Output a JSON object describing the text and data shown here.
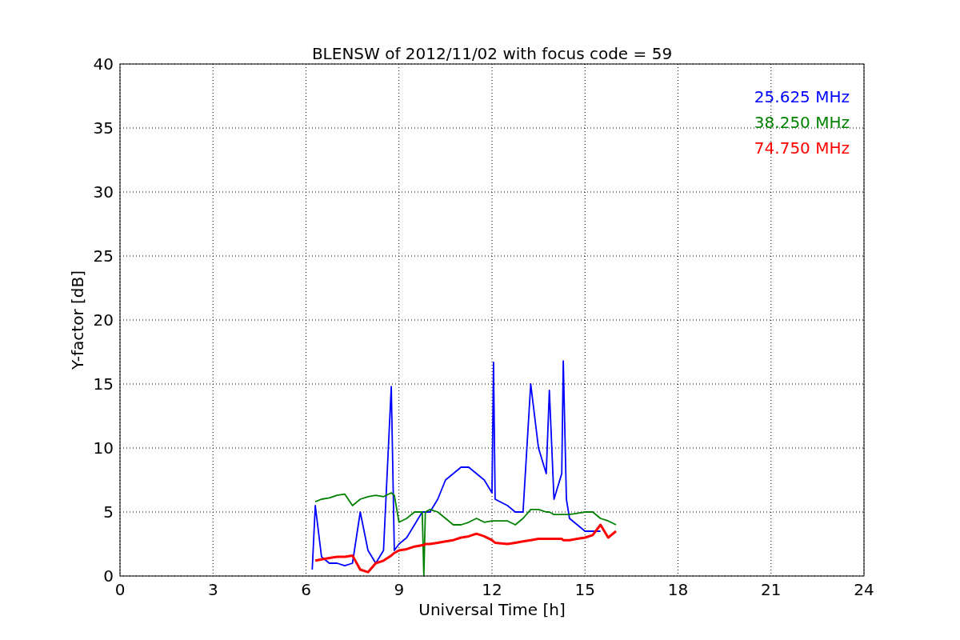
{
  "figure": {
    "chart_data": {
      "type": "line",
      "grid": true,
      "title": "BLENSW of 2012/11/02 with focus code = 59",
      "xlabel": "Universal Time [h]",
      "ylabel": "Y-factor [dB]",
      "xlim": [
        0,
        24
      ],
      "ylim": [
        0,
        40
      ],
      "xticks": [
        0,
        3,
        6,
        9,
        12,
        15,
        18,
        21,
        24
      ],
      "yticks": [
        0,
        5,
        10,
        15,
        20,
        25,
        30,
        35,
        40
      ],
      "x": [
        6.2,
        6.3,
        6.5,
        6.75,
        7,
        7.25,
        7.5,
        7.75,
        8,
        8.25,
        8.5,
        8.75,
        8.85,
        9,
        9.25,
        9.5,
        9.75,
        9.8,
        9.85,
        10,
        10.25,
        10.5,
        10.75,
        11,
        11.25,
        11.5,
        11.75,
        12,
        12.05,
        12.1,
        12.5,
        12.75,
        13,
        13.25,
        13.5,
        13.75,
        13.85,
        14,
        14.25,
        14.3,
        14.4,
        14.5,
        14.75,
        15,
        15.25,
        15.5,
        15.75,
        16
      ],
      "series": [
        {
          "name": "25.625 MHz",
          "color": "#0000ff",
          "values": [
            0.5,
            5.5,
            1.5,
            1,
            1,
            0.8,
            1,
            5,
            2,
            1,
            2,
            14.8,
            2,
            2.5,
            3,
            4,
            5,
            5,
            5,
            5,
            6,
            7.5,
            8,
            8.5,
            8.5,
            8,
            7.5,
            6.5,
            16.7,
            6,
            5.5,
            5,
            5,
            15,
            10,
            8,
            14.5,
            6,
            8,
            16.8,
            6,
            4.5,
            4,
            3.5,
            3.5,
            3.5,
            null,
            null
          ]
        },
        {
          "name": "38.250 MHz",
          "color": "#008000",
          "values": [
            null,
            5.8,
            6,
            6.1,
            6.3,
            6.4,
            5.5,
            6,
            6.2,
            6.3,
            6.2,
            6.5,
            6.3,
            4.2,
            4.5,
            5,
            5,
            0,
            5,
            5.2,
            5,
            4.5,
            4,
            4,
            4.2,
            4.5,
            4.2,
            4.3,
            4.3,
            4.3,
            4.3,
            4,
            4.5,
            5.2,
            5.2,
            5,
            5,
            4.8,
            4.8,
            4.8,
            4.8,
            4.8,
            4.9,
            5,
            5,
            4.5,
            4.3,
            4
          ]
        },
        {
          "name": "74.750 MHz",
          "color": "#ff0000",
          "values": [
            null,
            1.2,
            1.3,
            1.4,
            1.5,
            1.5,
            1.6,
            0.5,
            0.3,
            1,
            1.2,
            1.6,
            1.8,
            2,
            2.1,
            2.3,
            2.4,
            2.4,
            2.5,
            2.5,
            2.6,
            2.7,
            2.8,
            3,
            3.1,
            3.3,
            3.1,
            2.8,
            2.7,
            2.6,
            2.5,
            2.6,
            2.7,
            2.8,
            2.9,
            2.9,
            2.9,
            2.9,
            2.9,
            2.8,
            2.8,
            2.8,
            2.9,
            3,
            3.2,
            4,
            3,
            3.5
          ]
        }
      ]
    }
  }
}
